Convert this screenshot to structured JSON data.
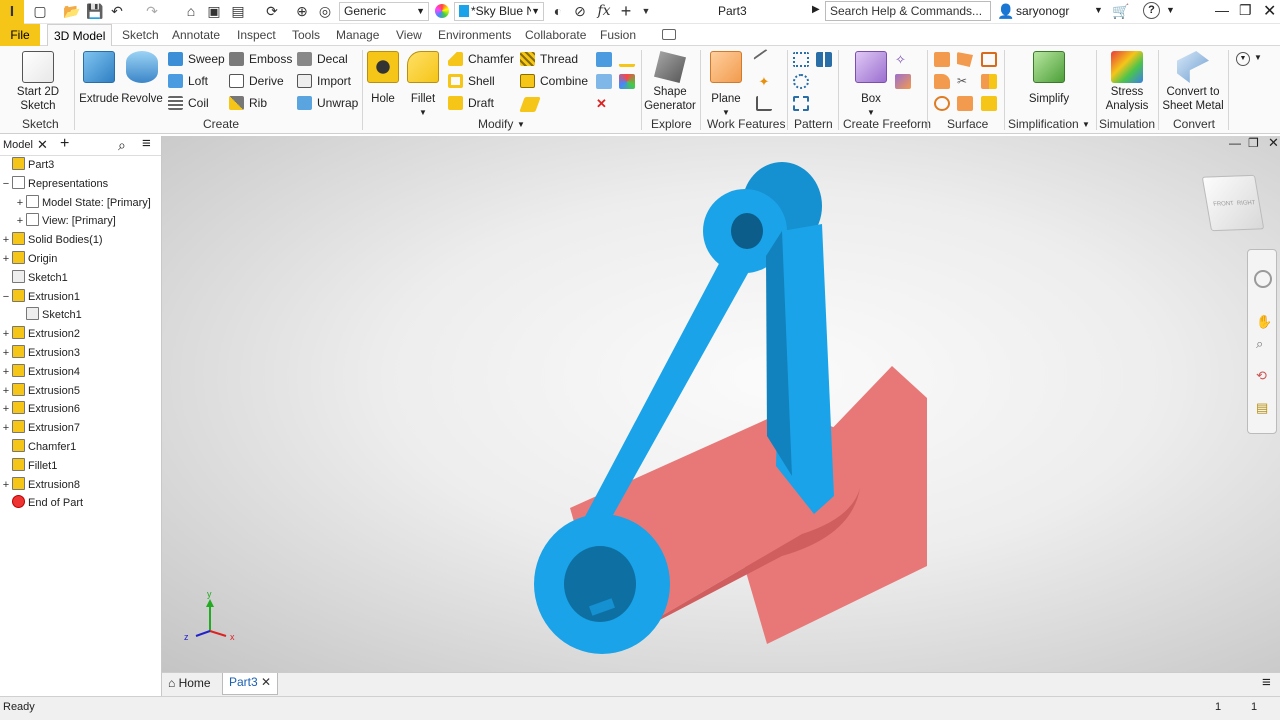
{
  "titlebar": {
    "app_letter": "I",
    "material": "Generic",
    "appearance": "*Sky Blue N",
    "doc_title": "Part3",
    "search_placeholder": "Search Help & Commands...",
    "username": "saryonogr"
  },
  "menu_tabs": [
    "File",
    "3D Model",
    "Sketch",
    "Annotate",
    "Inspect",
    "Tools",
    "Manage",
    "View",
    "Environments",
    "Collaborate",
    "Fusion"
  ],
  "ribbon": {
    "start_sketch": "Start 2D Sketch",
    "extrude": "Extrude",
    "revolve": "Revolve",
    "sweep": "Sweep",
    "loft": "Loft",
    "coil": "Coil",
    "emboss": "Emboss",
    "derive": "Derive",
    "rib": "Rib",
    "decal": "Decal",
    "import": "Import",
    "unwrap": "Unwrap",
    "hole": "Hole",
    "fillet": "Fillet",
    "chamfer": "Chamfer",
    "shell": "Shell",
    "draft": "Draft",
    "thread": "Thread",
    "combine": "Combine",
    "shape_generator": "Shape Generator",
    "plane": "Plane",
    "box": "Box",
    "simplify": "Simplify",
    "stress_analysis": "Stress Analysis",
    "convert_sheet_metal": "Convert to Sheet Metal",
    "panels": {
      "sketch": "Sketch",
      "create": "Create",
      "modify": "Modify",
      "explore": "Explore",
      "work_features": "Work Features",
      "pattern": "Pattern",
      "create_freeform": "Create Freeform",
      "surface": "Surface",
      "simplification": "Simplification",
      "simulation": "Simulation",
      "convert": "Convert"
    }
  },
  "browser": {
    "tab": "Model",
    "items": [
      {
        "label": "Part3",
        "indent": 0,
        "pm": ""
      },
      {
        "label": "Representations",
        "indent": 0,
        "pm": "−"
      },
      {
        "label": "Model State: [Primary]",
        "indent": 1,
        "pm": "+"
      },
      {
        "label": "View: [Primary]",
        "indent": 1,
        "pm": "+"
      },
      {
        "label": "Solid Bodies(1)",
        "indent": 0,
        "pm": "+"
      },
      {
        "label": "Origin",
        "indent": 0,
        "pm": "+"
      },
      {
        "label": "Sketch1",
        "indent": 0,
        "pm": ""
      },
      {
        "label": "Extrusion1",
        "indent": 0,
        "pm": "−"
      },
      {
        "label": "Sketch1",
        "indent": 1,
        "pm": ""
      },
      {
        "label": "Extrusion2",
        "indent": 0,
        "pm": "+"
      },
      {
        "label": "Extrusion3",
        "indent": 0,
        "pm": "+"
      },
      {
        "label": "Extrusion4",
        "indent": 0,
        "pm": "+"
      },
      {
        "label": "Extrusion5",
        "indent": 0,
        "pm": "+"
      },
      {
        "label": "Extrusion6",
        "indent": 0,
        "pm": "+"
      },
      {
        "label": "Extrusion7",
        "indent": 0,
        "pm": "+"
      },
      {
        "label": "Chamfer1",
        "indent": 0,
        "pm": ""
      },
      {
        "label": "Fillet1",
        "indent": 0,
        "pm": ""
      },
      {
        "label": "Extrusion8",
        "indent": 0,
        "pm": "+"
      },
      {
        "label": "End of Part",
        "indent": 0,
        "pm": ""
      }
    ]
  },
  "viewcube": {
    "front": "FRONT",
    "right": "RIGHT"
  },
  "axis": {
    "x": "x",
    "y": "y",
    "z": "z"
  },
  "doc_tabs": {
    "home": "Home",
    "part": "Part3"
  },
  "status": {
    "text": "Ready",
    "count1": "1",
    "count2": "1"
  },
  "colors": {
    "accent": "#f5c518",
    "part_blue": "#1aa3e8",
    "part_red": "#e87878"
  }
}
